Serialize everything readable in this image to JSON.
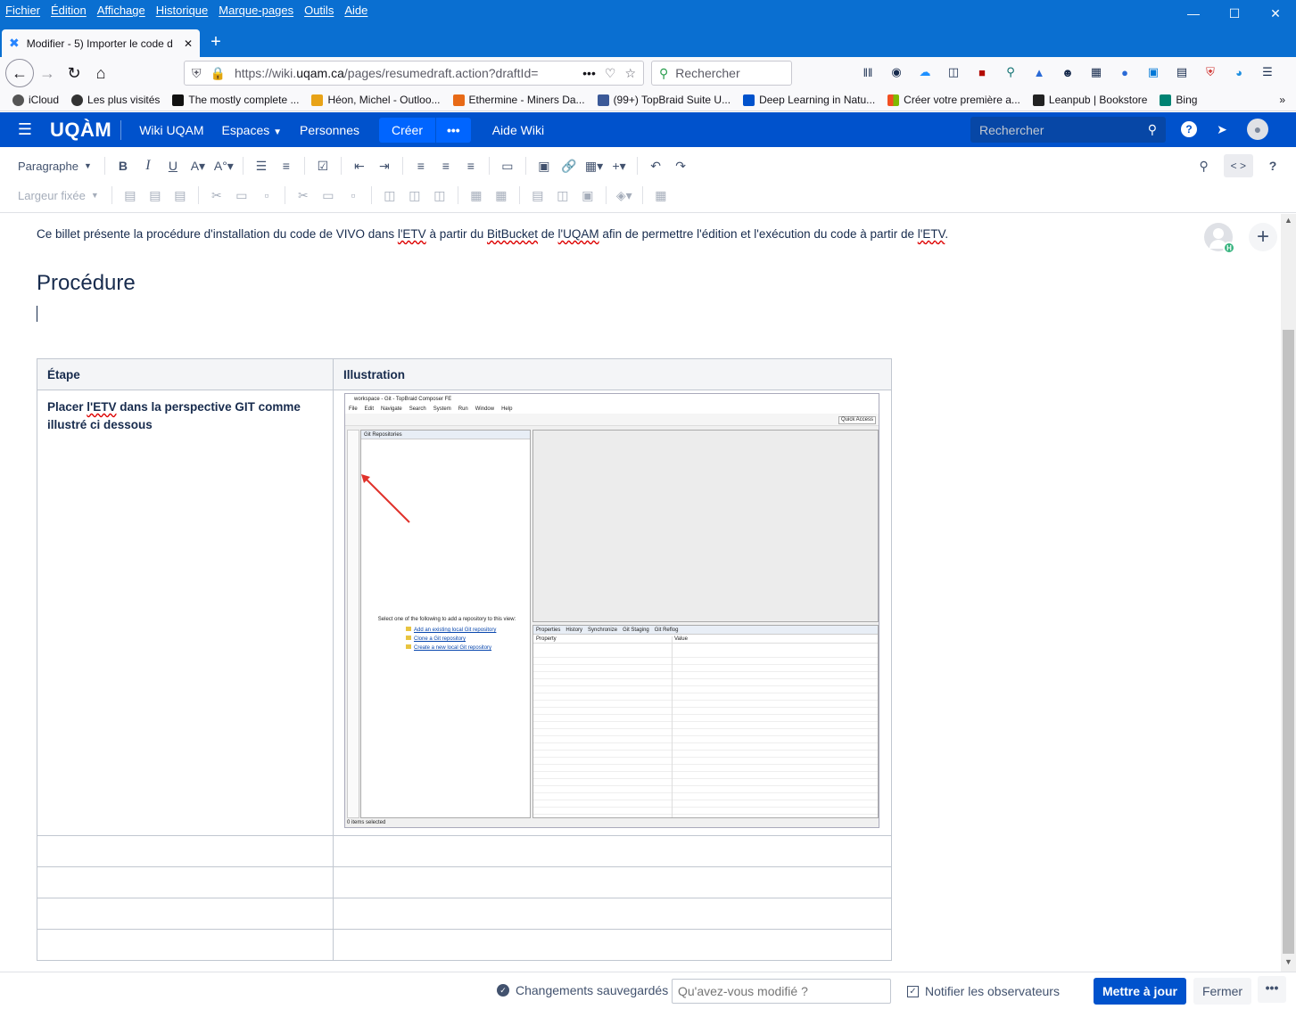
{
  "browser": {
    "menu": [
      "Fichier",
      "Édition",
      "Affichage",
      "Historique",
      "Marque-pages",
      "Outils",
      "Aide"
    ],
    "tab_title": "Modifier - 5) Importer le code d",
    "url_prefix": "https://wiki.",
    "url_domain": "uqam.ca",
    "url_rest": "/pages/resumedraft.action?draftId=",
    "search_placeholder": "Rechercher",
    "bookmarks": [
      {
        "label": "iCloud",
        "color": "#555555"
      },
      {
        "label": "Les plus visités",
        "color": "#333333"
      },
      {
        "label": "The mostly complete ...",
        "color": "#111111"
      },
      {
        "label": "Héon, Michel - Outloo...",
        "color": "#e8a317"
      },
      {
        "label": "Ethermine - Miners Da...",
        "color": "#e86a17"
      },
      {
        "label": "(99+) TopBraid Suite U...",
        "color": "#3b5998"
      },
      {
        "label": "Deep Learning in Natu...",
        "color": "#0052cc"
      },
      {
        "label": "Créer votre première a...",
        "color": "#f25022"
      },
      {
        "label": "Leanpub | Bookstore",
        "color": "#222222"
      },
      {
        "label": "Bing",
        "color": "#008373"
      }
    ]
  },
  "header": {
    "logo": "UQÀM",
    "wiki": "Wiki UQAM",
    "spaces": "Espaces",
    "people": "Personnes",
    "create": "Créer",
    "help_wiki": "Aide Wiki",
    "search_placeholder": "Rechercher",
    "brand_color": "#0052cc"
  },
  "toolbar": {
    "paragraph": "Paragraphe",
    "fixed_width": "Largeur fixée"
  },
  "content": {
    "intro_parts": [
      "Ce billet présente la procédure d'installation du code de VIVO dans ",
      "l'ETV",
      " à partir du ",
      "BitBucket",
      " de ",
      "l'UQAM",
      " afin de permettre l'édition et l'exécution du code à partir de ",
      "l'ETV",
      "."
    ],
    "heading": "Procédure",
    "collaborator_initial": "H",
    "table": {
      "col_step": "Étape",
      "col_illustration": "Illustration",
      "row1_step_a": "Placer ",
      "row1_step_etv": "l'ETV",
      "row1_step_b": " dans la perspective GIT comme illustré ci dessous"
    }
  },
  "screenshot": {
    "title": "workspace - Git - TopBraid Composer FE",
    "menu": [
      "File",
      "Edit",
      "Navigate",
      "Search",
      "System",
      "Run",
      "Window",
      "Help"
    ],
    "quick_access": "Quick Access",
    "git_tab": "Git Repositories",
    "select_text": "Select one of the following to add a repository to this view:",
    "links": [
      "Add an existing local Git repository",
      "Clone a Git repository",
      "Create a new local Git repository"
    ],
    "props_tabs": [
      "Properties",
      "History",
      "Synchronize",
      "Git Staging",
      "Git Reflog"
    ],
    "col_property": "Property",
    "col_value": "Value",
    "status": "0 items selected"
  },
  "footer": {
    "saved": "Changements sauvegardés",
    "change_placeholder": "Qu'avez-vous modifié ?",
    "notify": "Notifier les observateurs",
    "update": "Mettre à jour",
    "close": "Fermer"
  }
}
